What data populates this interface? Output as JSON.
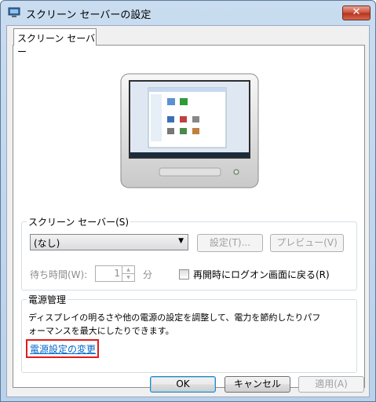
{
  "window": {
    "title": "スクリーン セーバーの設定",
    "close_label": "✕",
    "icon": "screen-saver-settings-icon"
  },
  "tab": {
    "label": "スクリーン セーバー"
  },
  "monitor": {
    "icon": "monitor-preview-icon"
  },
  "screensaver": {
    "group_label": "スクリーン セーバー(S)",
    "selected": "(なし)",
    "settings_button": "設定(T)...",
    "preview_button": "プレビュー(V)",
    "wait_label": "待ち時間(W):",
    "wait_value": "1",
    "wait_unit": "分",
    "resume_logon_label": "再開時にログオン画面に戻る(R)",
    "resume_logon_checked": false
  },
  "power": {
    "group_label": "電源管理",
    "description_line1": "ディスプレイの明るさや他の電源の設定を調整して、電力を節約したりパフ",
    "description_line2": "ォーマンスを最大にしたりできます。",
    "link": "電源設定の変更"
  },
  "footer": {
    "ok": "OK",
    "cancel": "キャンセル",
    "apply": "適用(A)"
  },
  "colors": {
    "link": "#0066cc",
    "highlight": "#e21b1b"
  }
}
